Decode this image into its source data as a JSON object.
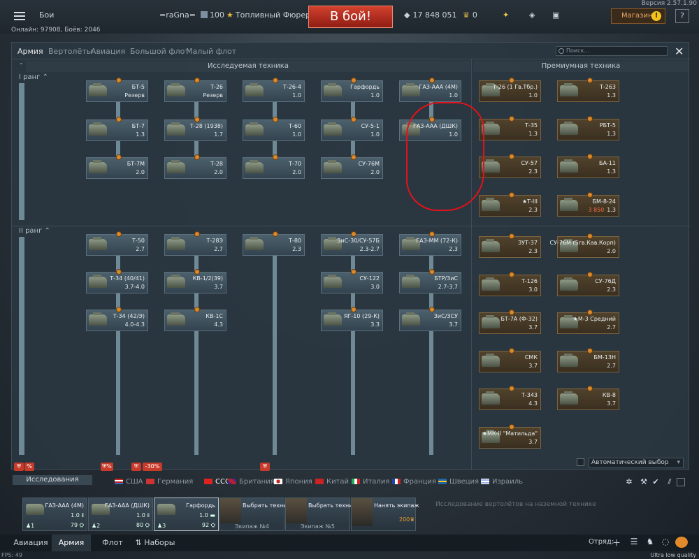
{
  "topbar": {
    "mode": "Бои",
    "username": "=raGna=",
    "level": "100",
    "title": "Топливный Фюрер",
    "battle_button": "В бой!",
    "silver": "17 848 051",
    "gold": "0",
    "shop": "Магазин",
    "help": "?",
    "version": "Версия 2.57.1.90",
    "online": "Онлайн: 97908, Боёв: 2046"
  },
  "tabs": [
    "Армия",
    "Вертолёты",
    "Авиация",
    "Большой флот",
    "Малый флот"
  ],
  "search_placeholder": "Поиск...",
  "headers": {
    "researched": "Исследуемая техника",
    "premium": "Премиумная техника"
  },
  "ranks": [
    "I ранг",
    "II ранг"
  ],
  "tree": [
    {
      "name": "БТ-5",
      "br": "Резерв"
    },
    {
      "name": "Т-26",
      "br": "Резерв"
    },
    {
      "name": "Т-26-4",
      "br": "1.0"
    },
    {
      "name": "Гарфордь",
      "br": "1.0"
    },
    {
      "name": "ГАЗ-ААА (4М)",
      "br": "1.0"
    },
    {
      "name": "БТ-7",
      "br": "1.3"
    },
    {
      "name": "Т-28 (1938)",
      "br": "1.7"
    },
    {
      "name": "Т-60",
      "br": "1.0"
    },
    {
      "name": "СУ-5-1",
      "br": "1.0"
    },
    {
      "name": "ГАЗ-ААА (ДШК)",
      "br": "1.0"
    },
    {
      "name": "БТ-7М",
      "br": "2.0"
    },
    {
      "name": "Т-28",
      "br": "2.0"
    },
    {
      "name": "Т-70",
      "br": "2.0"
    },
    {
      "name": "СУ-76М",
      "br": "2.0"
    },
    {
      "name": "Т-50",
      "br": "2.7"
    },
    {
      "name": "Т-28Э",
      "br": "2.7"
    },
    {
      "name": "Т-80",
      "br": "2.3"
    },
    {
      "name": "ЗиС-30/СУ-57Б",
      "br": "2.3-2.7"
    },
    {
      "name": "ГАЗ-ММ (72-К)",
      "br": "2.3"
    },
    {
      "name": "Т-34 (40/41)",
      "br": "3.7-4.0"
    },
    {
      "name": "КВ-1/2(39)",
      "br": "3.7"
    },
    {
      "name": "СУ-122",
      "br": "3.0"
    },
    {
      "name": "БТР/ЗиС",
      "br": "2.7-3.7"
    },
    {
      "name": "Т-34 (42/Э)",
      "br": "4.0-4.3"
    },
    {
      "name": "КВ-1С",
      "br": "4.3"
    },
    {
      "name": "ЯГ-10 (29-К)",
      "br": "3.3"
    },
    {
      "name": "ЗиС/ЗСУ",
      "br": "3.7"
    }
  ],
  "premium": [
    {
      "name": "Т-26 (1 Гв.Тбр.)",
      "br": "1.0",
      "extra": ""
    },
    {
      "name": "Т-263",
      "br": "1.3",
      "extra": ""
    },
    {
      "name": "Т-35",
      "br": "1.3",
      "extra": ""
    },
    {
      "name": "РБТ-5",
      "br": "1.3",
      "extra": ""
    },
    {
      "name": "СУ-57",
      "br": "2.3",
      "extra": ""
    },
    {
      "name": "БА-11",
      "br": "1.3",
      "extra": ""
    },
    {
      "name": "★Т-III",
      "br": "2.3",
      "extra": ""
    },
    {
      "name": "БМ-8-24",
      "br": "1.3",
      "extra": "3 850"
    },
    {
      "name": "ЗУТ-37",
      "br": "2.3",
      "extra": ""
    },
    {
      "name": "СУ-76М (5гв.Кав.Корп)",
      "br": "2.0",
      "extra": ""
    },
    {
      "name": "Т-126",
      "br": "3.0",
      "extra": ""
    },
    {
      "name": "СУ-76Д",
      "br": "2.3",
      "extra": ""
    },
    {
      "name": "БТ-7А (Ф-32)",
      "br": "3.7",
      "extra": ""
    },
    {
      "name": "★М-3 Средний",
      "br": "2.7",
      "extra": ""
    },
    {
      "name": "СМК",
      "br": "3.7",
      "extra": ""
    },
    {
      "name": "БМ-13Н",
      "br": "2.7",
      "extra": ""
    },
    {
      "name": "Т-343",
      "br": "4.3",
      "extra": ""
    },
    {
      "name": "КВ-8",
      "br": "3.7",
      "extra": ""
    },
    {
      "name": "★МК-II \"Матильда\"",
      "br": "3.7",
      "extra": ""
    }
  ],
  "bottom_option": "Исследование вертолётов на наземной технике",
  "auto_select": "Автоматический выбор",
  "boost_label": "-30%",
  "research_label": "Исследования",
  "nations": [
    "США",
    "Германия",
    "СССР",
    "Британия",
    "Япония",
    "Китай",
    "Италия",
    "Франция",
    "Швеция",
    "Израиль"
  ],
  "crew": {
    "slots": [
      {
        "name": "ГАЗ-ААА (4М)",
        "br": "1.0",
        "num": "1",
        "val": "79"
      },
      {
        "name": "ГАЗ-ААА (ДШК)",
        "br": "1.0",
        "num": "2",
        "val": "80"
      },
      {
        "name": "Гарфордь",
        "br": "1.0",
        "num": "3",
        "val": "92"
      }
    ],
    "pick": "Выбрать технику",
    "crew4": "Экипаж №4",
    "crew5": "Экипаж №5",
    "hire": "Нанять экипаж",
    "hire_cost": "200"
  },
  "bottom_tabs": [
    "Авиация",
    "Армия",
    "Флот",
    "Наборы"
  ],
  "squad": "Отряд:",
  "fps": "FPS: 49",
  "quality": "Ultra low quality",
  "colors": {
    "accent": "#d3412d",
    "panel": "#2a3640",
    "premium": "#50422c",
    "annotation": "#e3121a"
  }
}
